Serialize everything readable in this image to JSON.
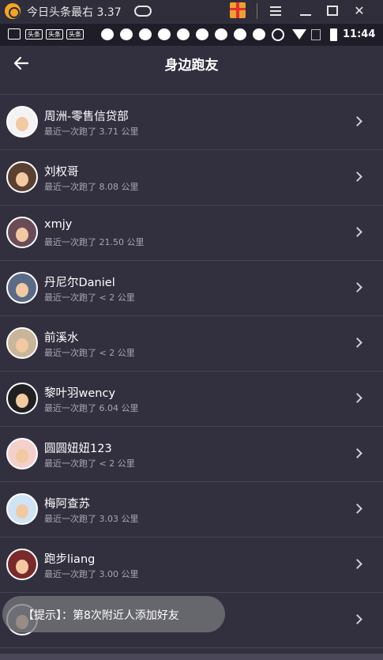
{
  "window": {
    "title": "今日头条最右 3.37",
    "icons": [
      "app-logo",
      "gamepad-icon",
      "gift-icon",
      "menu-icon",
      "minimize-icon",
      "maximize-icon",
      "close-icon"
    ]
  },
  "status_bar": {
    "time": "11:44",
    "app_badges": [
      "头条",
      "头条",
      "头条"
    ]
  },
  "header": {
    "title": "身边跑友"
  },
  "users": [
    {
      "name": "周洲-零售信贷部",
      "subtitle": "最近一次跑了 3.71 公里",
      "avatar_color": "#f3f3f3"
    },
    {
      "name": "刘权哥",
      "subtitle": "最近一次跑了 8.08 公里",
      "avatar_color": "#5a4030"
    },
    {
      "name": "xmjy",
      "subtitle": "最近一次跑了 21.50 公里",
      "avatar_color": "#6a4c58"
    },
    {
      "name": "丹尼尔Daniel",
      "subtitle": "最近一次跑了 < 2 公里",
      "avatar_color": "#5a6b88"
    },
    {
      "name": "前溪水",
      "subtitle": "最近一次跑了 < 2 公里",
      "avatar_color": "#c9b59a"
    },
    {
      "name": "黎叶羽wency",
      "subtitle": "最近一次跑了 6.04 公里",
      "avatar_color": "#202020"
    },
    {
      "name": "圆圆妞妞123",
      "subtitle": "最近一次跑了 < 2 公里",
      "avatar_color": "#f4d0cc"
    },
    {
      "name": "梅阿查苏",
      "subtitle": "最近一次跑了 3.03 公里",
      "avatar_color": "#cfe4f5"
    },
    {
      "name": "跑步liang",
      "subtitle": "最近一次跑了 3.00 公里",
      "avatar_color": "#7a2a2a"
    },
    {
      "name": "",
      "subtitle": "",
      "avatar_color": "#4e4c58"
    }
  ],
  "toast": {
    "text": "【提示】：第8次附近人添加好友"
  }
}
